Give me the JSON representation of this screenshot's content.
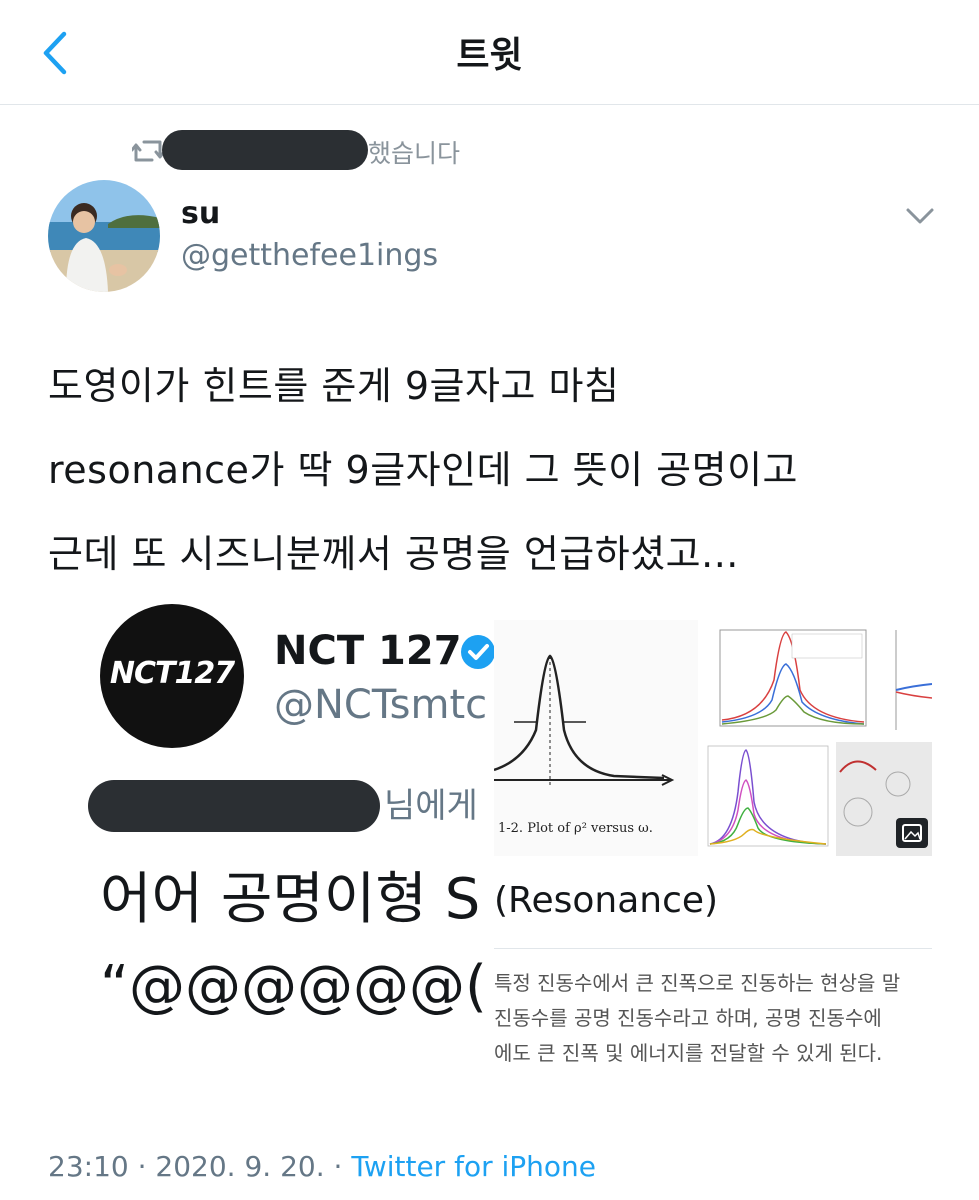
{
  "header": {
    "title": "트윗",
    "back_icon": "chevron-left-icon",
    "accent": "#1da1f2"
  },
  "retweet": {
    "suffix": "했습니다",
    "icon": "retweet-icon"
  },
  "author": {
    "name": "su",
    "handle": "@getthefee1ings"
  },
  "tweet": {
    "lines": [
      "도영이가 힌트를 준게 9글자고 마침",
      "resonance가 딱 9글자인데 그 뜻이 공명이고",
      "근데 또 시즈니분께서 공명을 언급하셨고..."
    ]
  },
  "media": {
    "account_logo": "NCT127",
    "account_name": "NCT 127",
    "account_handle": "@NCTsmtc",
    "mention_suffix": "님에게",
    "reply_text": "어어 공명이형 S",
    "quote_text": "“@@@@@@(",
    "plot_caption": "1-2.  Plot of ρ² versus ω.",
    "definition_title": "(Resonance)",
    "definition_lines": [
      "특정 진동수에서 큰 진폭으로 진동하는 현상을 말",
      "진동수를 공명 진동수라고 하며, 공명 진동수에",
      "에도 큰 진폭 및 에너지를 전달할 수 있게 된다."
    ]
  },
  "footer": {
    "time": "23:10",
    "date": "2020. 9. 20.",
    "separator": "·",
    "source": "Twitter for iPhone"
  }
}
